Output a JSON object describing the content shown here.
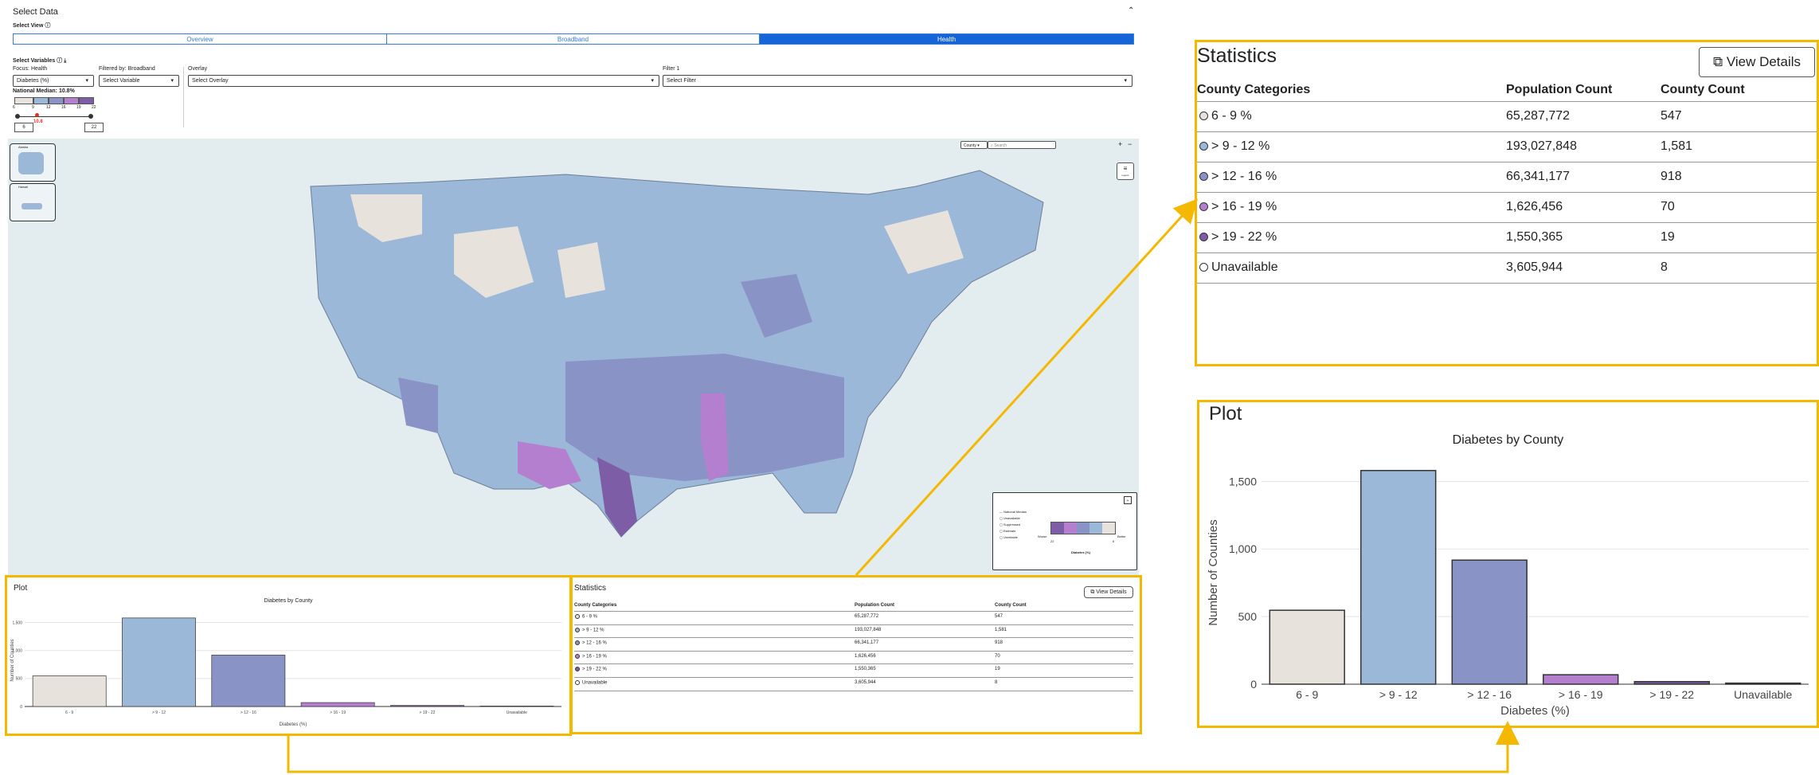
{
  "header": {
    "title": "Select Data",
    "select_view_label": "Select View"
  },
  "tabs": [
    {
      "label": "Overview",
      "active": false
    },
    {
      "label": "Broadband",
      "active": false
    },
    {
      "label": "Health",
      "active": true
    }
  ],
  "variables": {
    "label": "Select Variables",
    "focus_label": "Focus: Health",
    "focus_value": "Diabetes (%)",
    "filtered_label": "Filtered by: Broadband",
    "filtered_value": "Select Variable",
    "overlay_label": "Overlay",
    "overlay_value": "Select Overlay",
    "filter1_label": "Filter 1",
    "filter1_value": "Select Filter",
    "median_label": "National Median: 10.8%",
    "scale_ticks": [
      "6",
      "9",
      "12",
      "16",
      "19",
      "22"
    ],
    "median_marker": "10.8",
    "range_min": "6",
    "range_max": "22"
  },
  "map": {
    "geo_level": "County",
    "search_placeholder": "Search",
    "zoom_in": "+",
    "zoom_out": "−",
    "layers_label": "Layers",
    "inset_alaska": "Alaska",
    "inset_hawaii": "Hawaii",
    "legend": {
      "national_median": "National Median",
      "unavailable": "Unavailable",
      "suppressed": "Suppressed",
      "estimate": "Estimate",
      "unreliable": "Unreliable",
      "worse": "Worse",
      "better": "Better",
      "low": "22",
      "high": "6",
      "unit": "Diabetes (%)"
    }
  },
  "statistics": {
    "title": "Statistics",
    "view_details": "View Details",
    "headers": [
      "County Categories",
      "Population Count",
      "County Count"
    ],
    "rows": [
      {
        "category": "6 - 9 %",
        "population": "65,287,772",
        "counties": "547",
        "color": "#e8e2dc"
      },
      {
        "category": "> 9 - 12 %",
        "population": "193,027,848",
        "counties": "1,581",
        "color": "#9cb8d8"
      },
      {
        "category": "> 12 - 16 %",
        "population": "66,341,177",
        "counties": "918",
        "color": "#8a93c5"
      },
      {
        "category": "> 16 - 19 %",
        "population": "1,626,456",
        "counties": "70",
        "color": "#b57fcf"
      },
      {
        "category": "> 19 - 22 %",
        "population": "1,550,365",
        "counties": "19",
        "color": "#7d5da6"
      },
      {
        "category": "Unavailable",
        "population": "3,605,944",
        "counties": "8",
        "color": "#ffffff"
      }
    ]
  },
  "plot": {
    "title": "Plot"
  },
  "chart_data": {
    "type": "bar",
    "title": "Diabetes by County",
    "xlabel": "Diabetes (%)",
    "ylabel": "Number of Counties",
    "categories": [
      "6 - 9",
      "> 9 - 12",
      "> 12 - 16",
      "> 16 - 19",
      "> 19 - 22",
      "Unavailable"
    ],
    "values": [
      547,
      1581,
      918,
      70,
      19,
      8
    ],
    "colors": [
      "#e8e2dc",
      "#9cb8d8",
      "#8a93c5",
      "#b57fcf",
      "#7d5da6",
      "#6b6b6b"
    ],
    "ylim": [
      0,
      1650
    ],
    "yticks": [
      0,
      500,
      1000,
      1500
    ],
    "ytick_labels": [
      "0",
      "500",
      "1,000",
      "1,500"
    ],
    "grid": true
  }
}
